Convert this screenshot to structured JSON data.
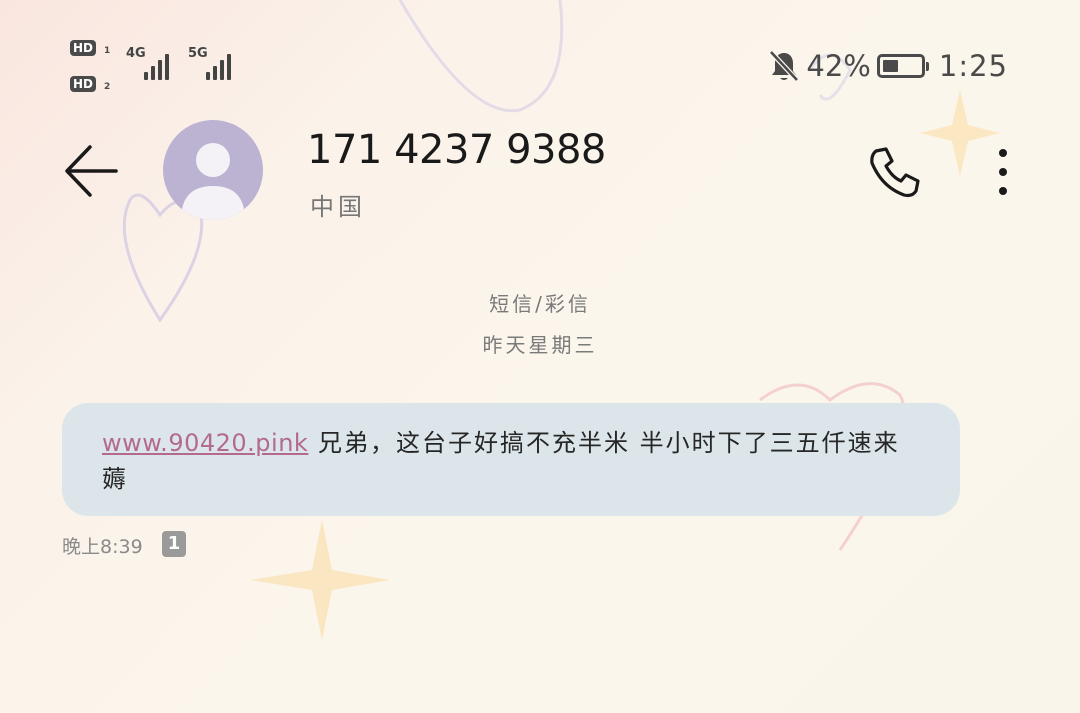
{
  "status_bar": {
    "hd1": "HD",
    "hd1_sim": "1",
    "hd2": "HD",
    "hd2_sim": "2",
    "net1": "4G",
    "net2": "5G",
    "battery_percent": "42%",
    "battery_level": 0.42,
    "time": "1:25",
    "icons": [
      "mute-bell-icon",
      "battery-icon",
      "signal-icon"
    ]
  },
  "header": {
    "contact_number": "171 4237 9388",
    "contact_region": "中国",
    "icons": [
      "back-arrow-icon",
      "avatar-icon",
      "phone-icon",
      "more-vertical-icon"
    ]
  },
  "thread": {
    "channel": "短信/彩信",
    "date_label": "昨天星期三"
  },
  "message": {
    "link": "www.90420.pink",
    "text": " 兄弟，这台子好搞不充半米 半小时下了三五仟速来薅",
    "time": "晚上8:39",
    "sim_badge": "1"
  },
  "colors": {
    "bubble": "#dce6ea",
    "link": "#b36a8e",
    "avatar": "#bcb2d2"
  }
}
